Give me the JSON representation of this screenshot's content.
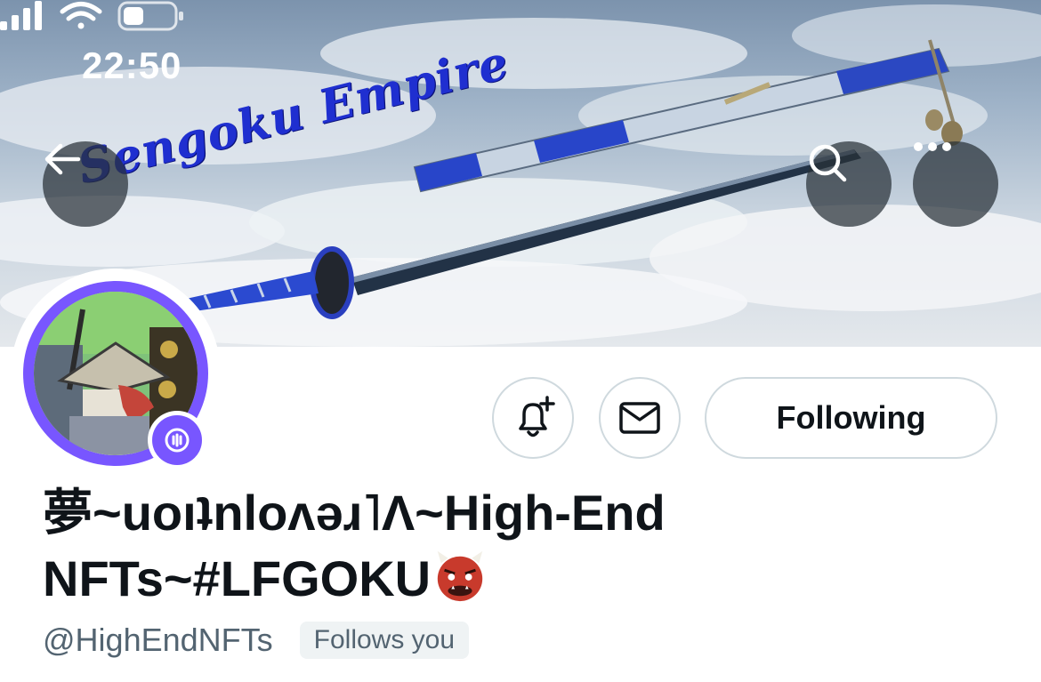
{
  "status_bar": {
    "time": "22:50"
  },
  "header": {
    "banner_text": "Sengoku Empire",
    "back_icon": "arrow-left-icon",
    "search_icon": "search-icon",
    "more_icon": "more-horizontal-icon"
  },
  "profile": {
    "display_name": "夢~uoıʇnloʌǝɹ˥Λ~High-End NFTs~#LFGOKU",
    "handle": "@HighEndNFTs",
    "follows_you_label": "Follows you"
  },
  "actions": {
    "notify_icon": "bell-plus-icon",
    "message_icon": "envelope-icon",
    "following_label": "Following"
  },
  "colors": {
    "accent": "#7856ff",
    "banner_text": "#1f2fd0",
    "secondary_text": "#536471",
    "button_border": "#cfd9de"
  }
}
